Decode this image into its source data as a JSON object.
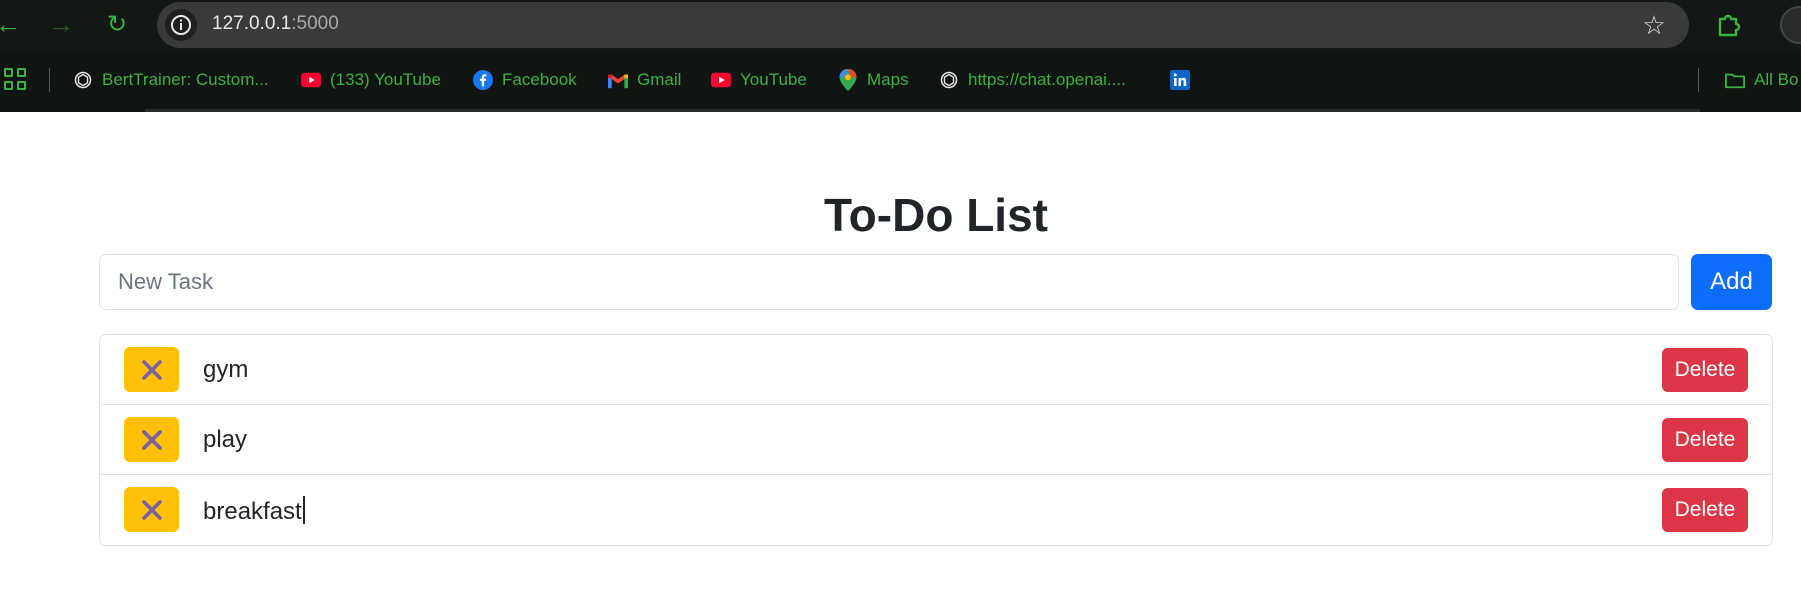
{
  "browser": {
    "url_host": "127.0.0.1",
    "url_port": ":5000",
    "bookmarks": [
      {
        "label": "BertTrainer: Custom...",
        "icon": "openai-icon"
      },
      {
        "label": "(133) YouTube",
        "icon": "youtube-icon"
      },
      {
        "label": "Facebook",
        "icon": "facebook-icon"
      },
      {
        "label": "Gmail",
        "icon": "gmail-icon"
      },
      {
        "label": "YouTube",
        "icon": "youtube-icon"
      },
      {
        "label": "Maps",
        "icon": "maps-icon"
      },
      {
        "label": "https://chat.openai....",
        "icon": "openai-icon"
      },
      {
        "label": "",
        "icon": "linkedin-icon"
      }
    ],
    "all_bookmarks_label": "All Bo",
    "accent_color": "#3cb043"
  },
  "app": {
    "title": "To-Do List",
    "input_placeholder": "New Task",
    "add_label": "Add",
    "tasks": [
      {
        "text": "gym",
        "delete_label": "Delete"
      },
      {
        "text": "play",
        "delete_label": "Delete"
      },
      {
        "text": "breakfast",
        "delete_label": "Delete"
      }
    ],
    "colors": {
      "primary": "#0d6efd",
      "danger": "#dc3545",
      "warning": "#ffc107",
      "toggle_x": "#7b5ea7"
    }
  }
}
